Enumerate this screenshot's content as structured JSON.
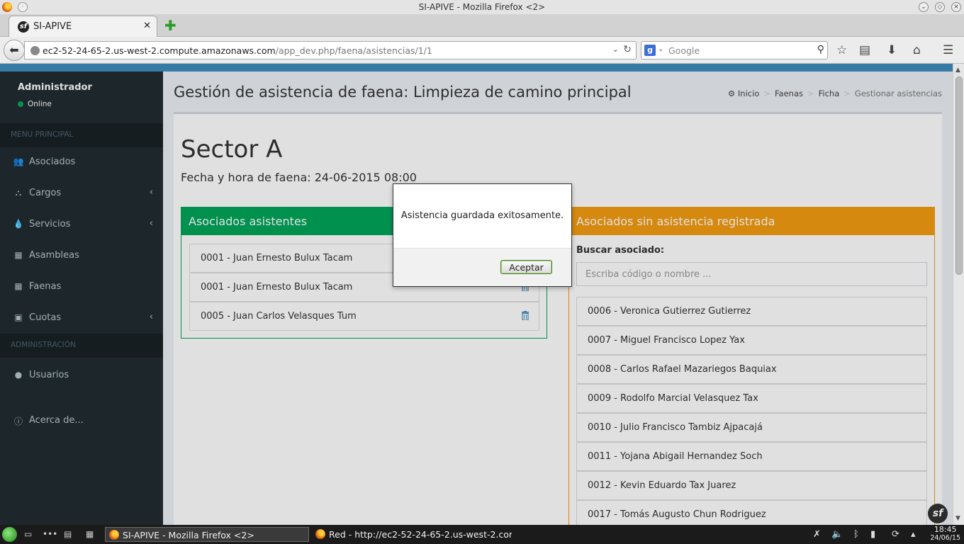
{
  "window": {
    "title": "SI-APIVE - Mozilla Firefox <2>"
  },
  "browser": {
    "tab_title": "SI-APIVE",
    "url_host": "ec2-52-24-65-2.us-west-2.compute.amazonaws.com",
    "url_path": "/app_dev.php/faena/asistencias/1/1",
    "search_placeholder": "Google"
  },
  "sidebar": {
    "user_name": "Administrador",
    "user_status": "Online",
    "header_main": "MENU PRINCIPAL",
    "header_admin": "ADMINISTRACIÓN",
    "items": [
      {
        "label": "Asociados",
        "icon": "users-icon"
      },
      {
        "label": "Cargos",
        "icon": "sitemap-icon"
      },
      {
        "label": "Servicios",
        "icon": "tint-icon"
      },
      {
        "label": "Asambleas",
        "icon": "calendar-icon"
      },
      {
        "label": "Faenas",
        "icon": "calendar-icon"
      },
      {
        "label": "Cuotas",
        "icon": "money-icon"
      },
      {
        "label": "Usuarios",
        "icon": "user-icon"
      },
      {
        "label": "Acerca de...",
        "icon": "info-icon"
      }
    ]
  },
  "header": {
    "title": "Gestión de asistencia de faena: Limpieza de camino principal",
    "breadcrumb": [
      "Inicio",
      "Faenas",
      "Ficha",
      "Gestionar asistencias"
    ]
  },
  "main": {
    "sector_title": "Sector A",
    "datetime": "Fecha y hora de faena: 24-06-2015 08:00",
    "attendees_title": "Asociados asistentes",
    "attendees": [
      "0001 - Juan Ernesto Bulux Tacam",
      "0001 - Juan Ernesto Bulux Tacam",
      "0005 - Juan Carlos Velasques Tum"
    ],
    "absent_title": "Asociados sin asistencia registrada",
    "search_label": "Buscar asociado:",
    "search_placeholder": "Escriba código o nombre ...",
    "absent": [
      "0006 - Veronica Gutierrez Gutierrez",
      "0007 - Miguel Francisco Lopez Yax",
      "0008 - Carlos Rafael Mazariegos Baquiax",
      "0009 - Rodolfo Marcial Velasquez Tax",
      "0010 - Julio Francisco Tambiz Ajpacajá",
      "0011 - Yojana Abigail Hernandez Soch",
      "0012 - Kevin Eduardo Tax Juarez",
      "0017 - Tomás Augusto Chun Rodriguez"
    ]
  },
  "dialog": {
    "message": "Asistencia guardada exitosamente.",
    "ok_label": "Aceptar"
  },
  "taskbar": {
    "task_active": "SI-APIVE - Mozilla Firefox <2>",
    "task_other": "Red - http://ec2-52-24-65-2.us-west-2.com",
    "time": "18:45",
    "date": "24/06/15"
  },
  "colors": {
    "success": "#00a65a",
    "warning": "#f39c12",
    "sidebar_bg": "#222d32",
    "header_blue": "#3c8dbc"
  }
}
